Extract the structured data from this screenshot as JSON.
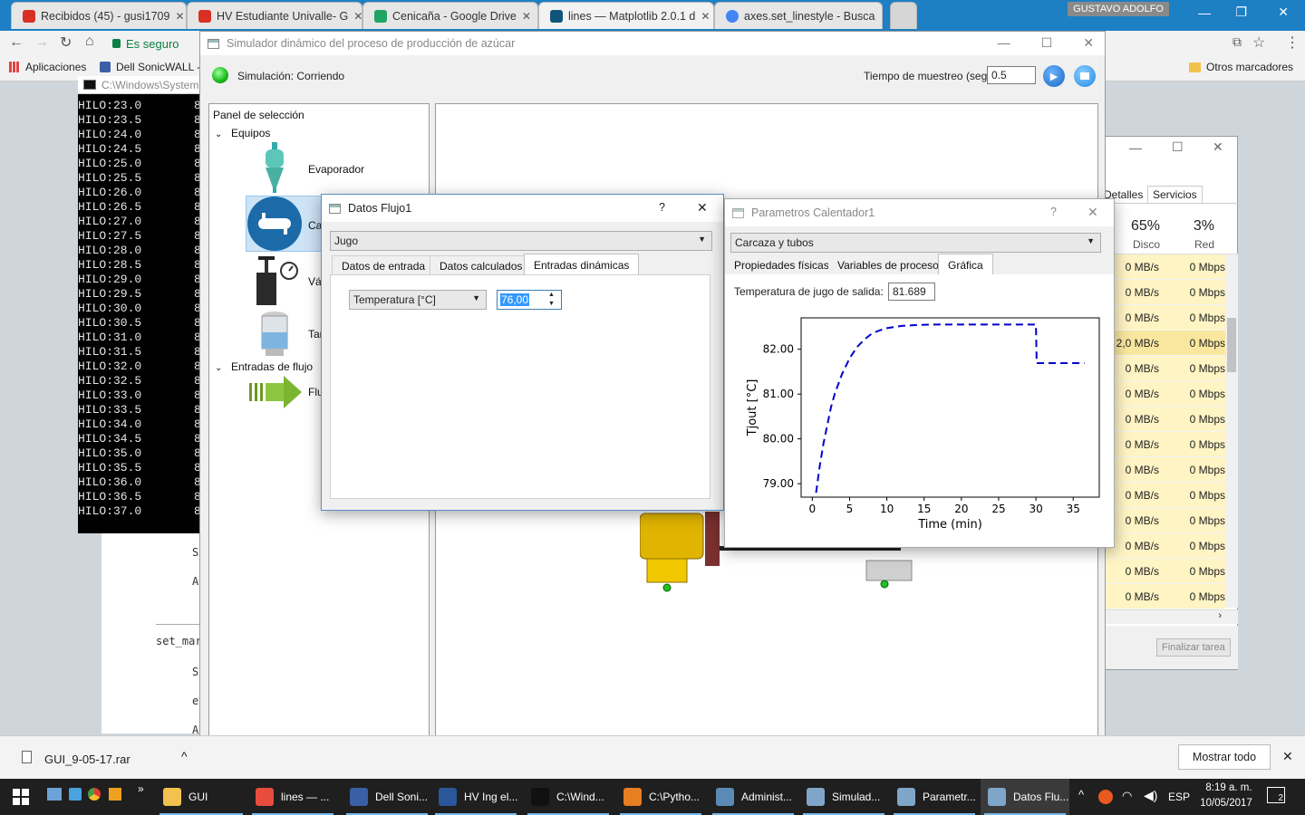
{
  "browser": {
    "tabs": [
      {
        "label": "Recibidos (45) - gusi1709",
        "icon": "gmail-icon",
        "color": "#d93025"
      },
      {
        "label": "HV Estudiante Univalle- G",
        "icon": "gmail-icon",
        "color": "#d93025"
      },
      {
        "label": "Cenicaña - Google Drive",
        "icon": "drive-icon",
        "color": "#1fa463"
      },
      {
        "label": "lines — Matplotlib 2.0.1 d",
        "icon": "matplotlib-icon",
        "color": "#11557c"
      },
      {
        "label": "axes.set_linestyle - Busca",
        "icon": "google-icon",
        "color": "#4285f4"
      }
    ],
    "profile": "GUSTAVO ADOLFO",
    "secure_label": "Es seguro",
    "bookmarks": [
      "Aplicaciones",
      "Dell SonicWALL -",
      "Otros marcadores"
    ]
  },
  "console": {
    "title": "C:\\Windows\\System",
    "lines": [
      "HILO:23.0",
      "HILO:23.5",
      "HILO:24.0",
      "HILO:24.5",
      "HILO:25.0",
      "HILO:25.5",
      "HILO:26.0",
      "HILO:26.5",
      "HILO:27.0",
      "HILO:27.5",
      "HILO:28.0",
      "HILO:28.5",
      "HILO:29.0",
      "HILO:29.5",
      "HILO:30.0",
      "HILO:30.5",
      "HILO:31.0",
      "HILO:31.5",
      "HILO:32.0",
      "HILO:32.5",
      "HILO:33.0",
      "HILO:33.5",
      "HILO:34.0",
      "HILO:34.5",
      "HILO:35.0",
      "HILO:35.5",
      "HILO:36.0",
      "HILO:36.5",
      "HILO:37.0"
    ],
    "trail": "8"
  },
  "webpage": {
    "letters": [
      "S",
      "A",
      "S",
      "e",
      "A"
    ],
    "code": "set_mar"
  },
  "simulator": {
    "title": "Simulador dinámico del proceso de producción de azúcar",
    "status": "Simulación: Corriendo",
    "sample_label": "Tiempo de muestreo (seg):",
    "sample_value": "0.5",
    "panel_title": "Panel de selección",
    "tree": {
      "equipos": "Equipos",
      "items": [
        {
          "label": "Evaporador",
          "icon": "evaporator-icon"
        },
        {
          "label": "Ca",
          "icon": "heat-exchanger-icon"
        },
        {
          "label": "Vál",
          "icon": "valve-icon"
        },
        {
          "label": "Tar",
          "icon": "tank-icon"
        }
      ],
      "entradas": "Entradas de flujo",
      "flujo": {
        "label": "Flu",
        "icon": "flow-arrow-icon"
      }
    }
  },
  "taskmgr": {
    "tabs": [
      "Detalles",
      "Servicios"
    ],
    "disk_pct": "65%",
    "disk_label": "Disco",
    "net_pct": "3%",
    "net_label": "Red",
    "rows": [
      [
        "0 MB/s",
        "0 Mbps"
      ],
      [
        "0 MB/s",
        "0 Mbps"
      ],
      [
        "0 MB/s",
        "0 Mbps"
      ],
      [
        "2,0 MB/s",
        "0 Mbps"
      ],
      [
        "0 MB/s",
        "0 Mbps"
      ],
      [
        "0 MB/s",
        "0 Mbps"
      ],
      [
        "0 MB/s",
        "0 Mbps"
      ],
      [
        "0 MB/s",
        "0 Mbps"
      ],
      [
        "0 MB/s",
        "0 Mbps"
      ],
      [
        "0 MB/s",
        "0 Mbps"
      ],
      [
        "0 MB/s",
        "0 Mbps"
      ],
      [
        "0 MB/s",
        "0 Mbps"
      ],
      [
        "0 MB/s",
        "0 Mbps"
      ],
      [
        "0 MB/s",
        "0 Mbps"
      ]
    ],
    "end_task": "Finalizar tarea"
  },
  "flujo_dialog": {
    "title": "Datos Flujo1",
    "help": "?",
    "combo": "Jugo",
    "tabs": [
      "Datos de entrada",
      "Datos calculados",
      "Entradas dinámicas"
    ],
    "var_combo": "Temperatura [°C]",
    "spin_value": "76,00"
  },
  "calentador_dialog": {
    "title": "Parametros Calentador1",
    "help": "?",
    "combo": "Carcaza y tubos",
    "tabs": [
      "Propiedades físicas",
      "Variables de proceso",
      "Gráfica"
    ],
    "out_label": "Temperatura de jugo de salida:",
    "out_value": "81.689"
  },
  "chart_data": {
    "type": "line",
    "xlabel": "Time (min)",
    "ylabel": "Tjout [°C]",
    "xlim": [
      -1.5,
      38.5
    ],
    "ylim": [
      78.7,
      82.7
    ],
    "xticks": [
      0,
      5,
      10,
      15,
      20,
      25,
      30,
      35
    ],
    "yticks": [
      79.0,
      80.0,
      81.0,
      82.0
    ],
    "ytick_labels": [
      "79.00",
      "80.00",
      "81.00",
      "82.00"
    ],
    "color": "#0000cc",
    "linestyle": "dashed",
    "series": [
      {
        "x": [
          0.5,
          1,
          1.5,
          2,
          2.5,
          3,
          4,
          5,
          6,
          7,
          8,
          9,
          10,
          12,
          14,
          16,
          18,
          20,
          22,
          24,
          26,
          28,
          29,
          30,
          30.1,
          31,
          32,
          33,
          34,
          35,
          36.5
        ],
        "y": [
          78.8,
          79.4,
          79.9,
          80.3,
          80.7,
          81.0,
          81.45,
          81.8,
          82.05,
          82.22,
          82.35,
          82.42,
          82.47,
          82.52,
          82.54,
          82.55,
          82.55,
          82.55,
          82.55,
          82.55,
          82.55,
          82.55,
          82.55,
          82.55,
          81.69,
          81.69,
          81.69,
          81.69,
          81.69,
          81.69,
          81.69
        ]
      }
    ]
  },
  "download": {
    "file": "GUI_9-05-17.rar",
    "show_all": "Mostrar todo"
  },
  "taskbar": {
    "items": [
      {
        "label": "GUI",
        "icon": "folder-icon",
        "color": "#f2c14e"
      },
      {
        "label": "lines — ...",
        "icon": "chrome-icon",
        "color": "#e74c3c"
      },
      {
        "label": "Dell Soni...",
        "icon": "shield-icon",
        "color": "#3b5fa5"
      },
      {
        "label": "HV Ing el...",
        "icon": "word-icon",
        "color": "#2b579a"
      },
      {
        "label": "C:\\Wind...",
        "icon": "cmd-icon",
        "color": "#111111"
      },
      {
        "label": "C:\\Pytho...",
        "icon": "sublime-icon",
        "color": "#e67e22"
      },
      {
        "label": "Administ...",
        "icon": "taskmgr-icon",
        "color": "#5b8bb5"
      },
      {
        "label": "Simulad...",
        "icon": "window-icon",
        "color": "#7fa6c9"
      },
      {
        "label": "Parametr...",
        "icon": "window-icon",
        "color": "#7fa6c9"
      },
      {
        "label": "Datos Flu...",
        "icon": "window-icon",
        "color": "#7fa6c9"
      }
    ],
    "lang": "ESP",
    "time": "8:19 a. m.",
    "date": "10/05/2017",
    "notif": "2"
  }
}
